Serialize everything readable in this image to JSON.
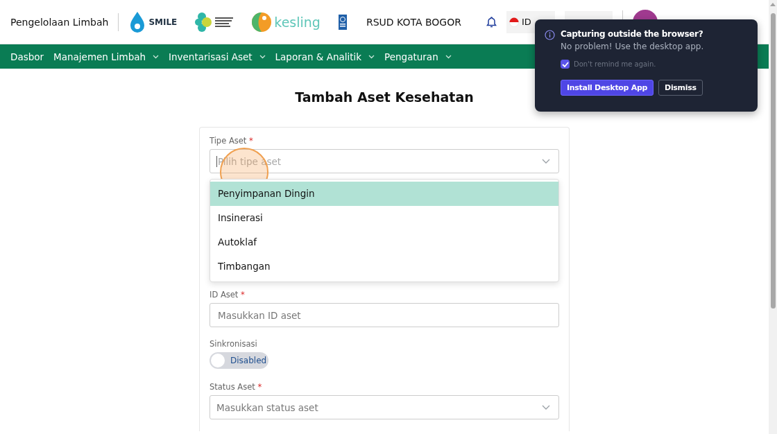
{
  "header": {
    "app_title": "Pengelolaan Limbah",
    "logos": [
      {
        "kind": "smile",
        "text": "SMILE"
      },
      {
        "kind": "kemenkes"
      },
      {
        "kind": "kesling",
        "text": "kesling"
      },
      {
        "kind": "undp"
      }
    ],
    "hospital": "RSUD KOTA BOGOR",
    "language": "ID"
  },
  "nav": [
    {
      "label": "Dasbor",
      "has_menu": false
    },
    {
      "label": "Manajemen Limbah",
      "has_menu": true
    },
    {
      "label": "Inventarisasi Aset",
      "has_menu": true
    },
    {
      "label": "Laporan & Analitik",
      "has_menu": true
    },
    {
      "label": "Pengaturan",
      "has_menu": true
    }
  ],
  "page_title": "Tambah Aset Kesehatan",
  "form": {
    "fields": [
      {
        "kind": "select",
        "label": "Tipe Aset",
        "required_mark": "*",
        "placeholder": "Pilih tipe aset",
        "expanded": true,
        "options": [
          {
            "label": "Penyimpanan Dingin",
            "selected": true
          },
          {
            "label": "Insinerasi",
            "selected": false
          },
          {
            "label": "Autoklaf",
            "selected": false
          },
          {
            "label": "Timbangan",
            "selected": false
          }
        ]
      },
      {
        "kind": "text",
        "label": "ID Aset",
        "required_mark": "*",
        "placeholder": "Masukkan ID aset"
      },
      {
        "kind": "toggle",
        "label": "Sinkronisasi",
        "on": false,
        "state_text": "Disabled"
      },
      {
        "kind": "select",
        "label": "Status Aset",
        "required_mark": "*",
        "placeholder": "Masukkan status aset",
        "expanded": false
      }
    ]
  },
  "popup": {
    "title": "Capturing outside the browser?",
    "message": "No problem! Use the desktop app.",
    "checkbox": {
      "label": "Don't remind me again.",
      "checked": true
    },
    "buttons": [
      {
        "label": "Install Desktop App",
        "kind": "primary"
      },
      {
        "label": "Dismiss",
        "kind": "secondary"
      }
    ]
  }
}
